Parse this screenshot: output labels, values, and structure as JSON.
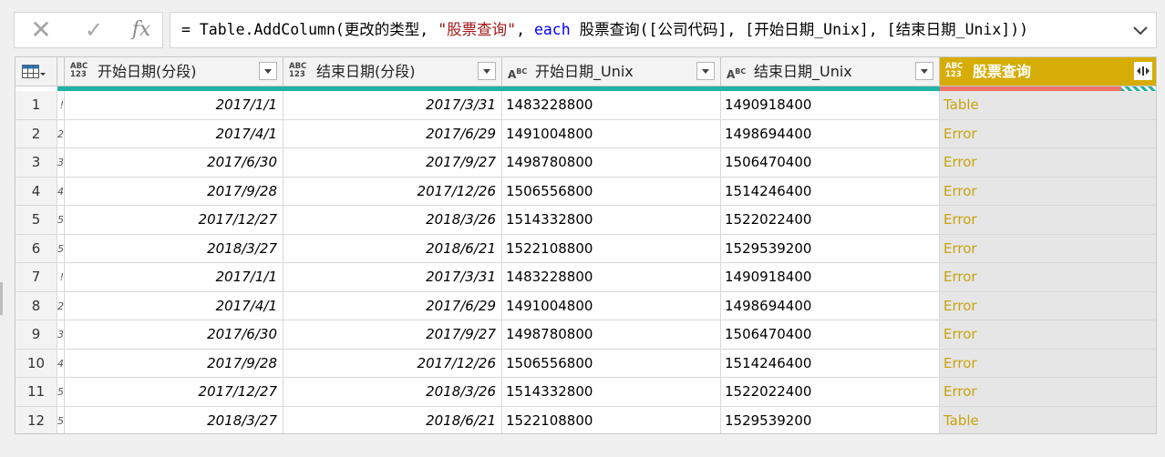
{
  "formula_bar": {
    "cancel_icon": "close-icon",
    "confirm_icon": "check-icon",
    "fx_label": "fx",
    "formula_prefix": "= Table.AddColumn(更改的类型, ",
    "formula_string": "\"股票查询\"",
    "formula_sep": ", ",
    "formula_keyword": "each",
    "formula_suffix": " 股票查询([公司代码], [开始日期_Unix], [结束日期_Unix]))"
  },
  "grid": {
    "columns": [
      {
        "type_top": "ABC",
        "type_bottom": "123",
        "title": "开始日期(分段)"
      },
      {
        "type_top": "ABC",
        "type_bottom": "123",
        "title": "结束日期(分段)"
      },
      {
        "type_top": "A",
        "type_bottom": "BC",
        "title": "开始日期_Unix"
      },
      {
        "type_top": "A",
        "type_bottom": "BC",
        "title": "结束日期_Unix"
      },
      {
        "type_top": "ABC",
        "type_bottom": "123",
        "title": "股票查询"
      }
    ],
    "rows": [
      {
        "n": "1",
        "clip": "!",
        "start": "2017/1/1",
        "end": "2017/3/31",
        "su": "1483228800",
        "eu": "1490918400",
        "q": "Table"
      },
      {
        "n": "2",
        "clip": "2",
        "start": "2017/4/1",
        "end": "2017/6/29",
        "su": "1491004800",
        "eu": "1498694400",
        "q": "Error"
      },
      {
        "n": "3",
        "clip": "3",
        "start": "2017/6/30",
        "end": "2017/9/27",
        "su": "1498780800",
        "eu": "1506470400",
        "q": "Error"
      },
      {
        "n": "4",
        "clip": "4",
        "start": "2017/9/28",
        "end": "2017/12/26",
        "su": "1506556800",
        "eu": "1514246400",
        "q": "Error"
      },
      {
        "n": "5",
        "clip": "5",
        "start": "2017/12/27",
        "end": "2018/3/26",
        "su": "1514332800",
        "eu": "1522022400",
        "q": "Error"
      },
      {
        "n": "6",
        "clip": "5",
        "start": "2018/3/27",
        "end": "2018/6/21",
        "su": "1522108800",
        "eu": "1529539200",
        "q": "Error"
      },
      {
        "n": "7",
        "clip": "!",
        "start": "2017/1/1",
        "end": "2017/3/31",
        "su": "1483228800",
        "eu": "1490918400",
        "q": "Error"
      },
      {
        "n": "8",
        "clip": "2",
        "start": "2017/4/1",
        "end": "2017/6/29",
        "su": "1491004800",
        "eu": "1498694400",
        "q": "Error"
      },
      {
        "n": "9",
        "clip": "3",
        "start": "2017/6/30",
        "end": "2017/9/27",
        "su": "1498780800",
        "eu": "1506470400",
        "q": "Error"
      },
      {
        "n": "10",
        "clip": "4",
        "start": "2017/9/28",
        "end": "2017/12/26",
        "su": "1506556800",
        "eu": "1514246400",
        "q": "Error"
      },
      {
        "n": "11",
        "clip": "5",
        "start": "2017/12/27",
        "end": "2018/3/26",
        "su": "1514332800",
        "eu": "1522022400",
        "q": "Error"
      },
      {
        "n": "12",
        "clip": "5",
        "start": "2018/3/27",
        "end": "2018/6/21",
        "su": "1522108800",
        "eu": "1529539200",
        "q": "Table"
      }
    ]
  },
  "colors": {
    "selected_header": "#d6ad07",
    "quality_valid": "#1fb3a5",
    "quality_error": "#f07468",
    "cell_text_error": "#c8a30e"
  }
}
